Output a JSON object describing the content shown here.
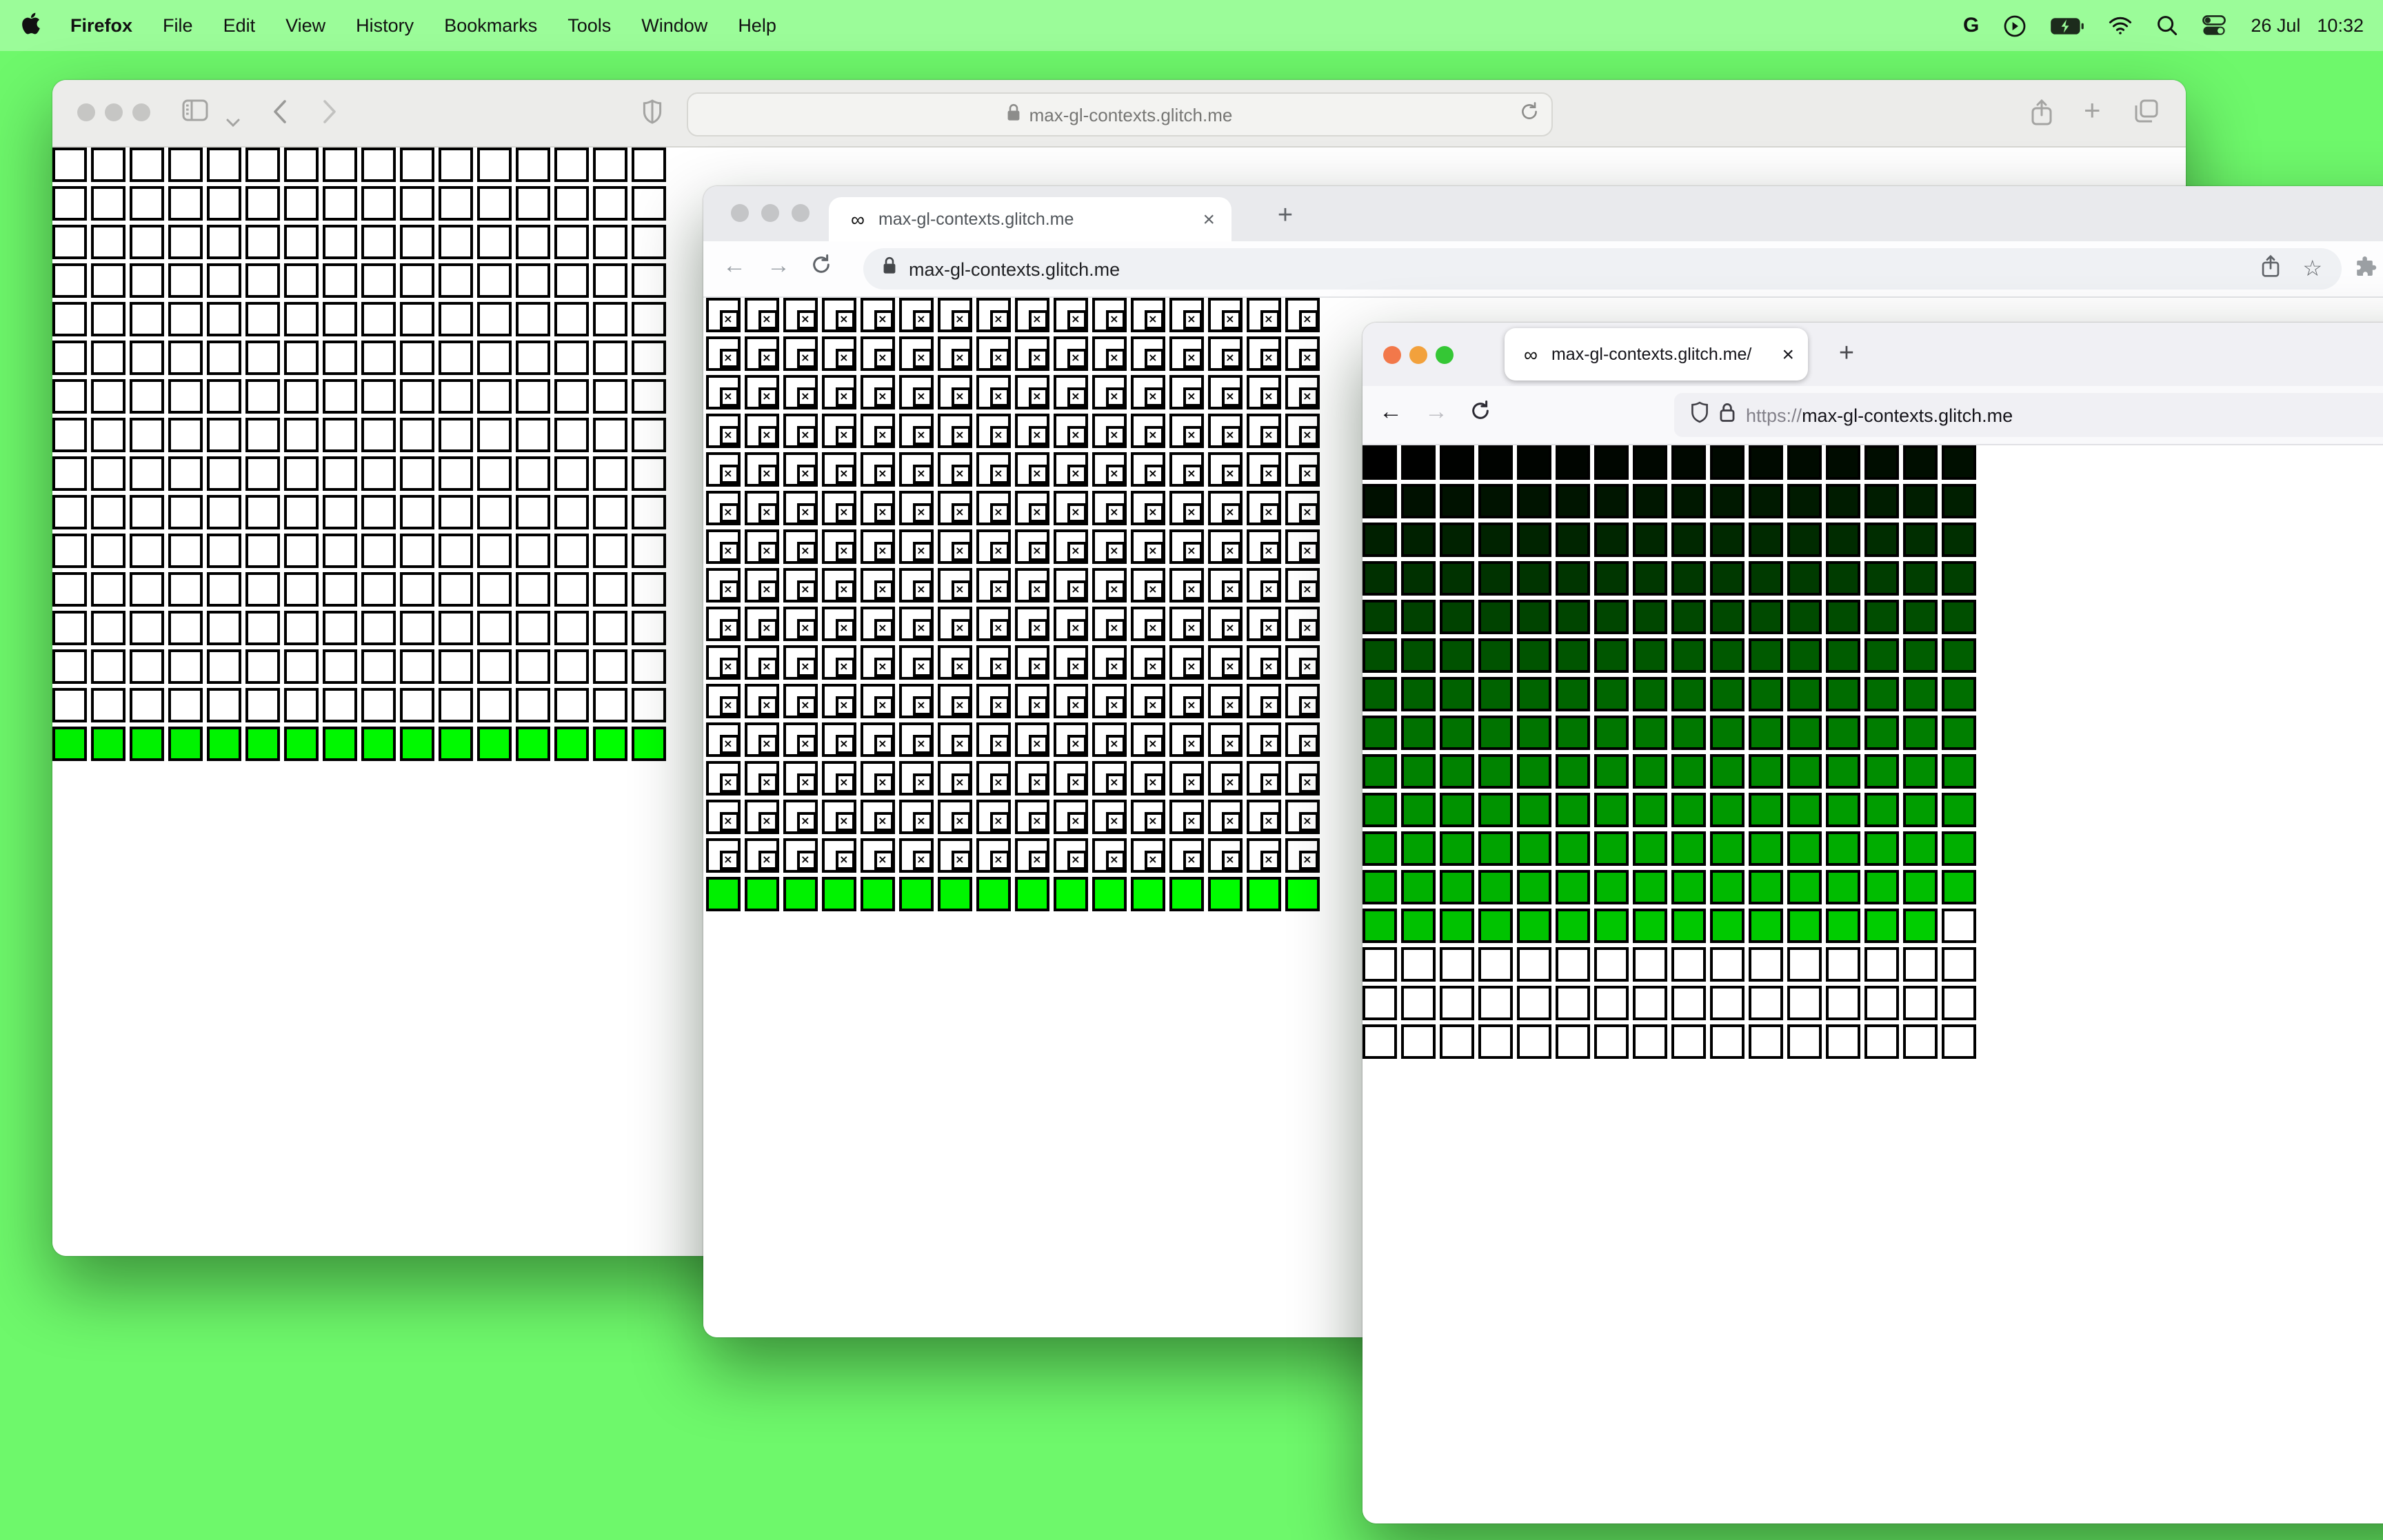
{
  "menu_bar": {
    "app_name": "Firefox",
    "items": [
      "File",
      "Edit",
      "View",
      "History",
      "Bookmarks",
      "Tools",
      "Window",
      "Help"
    ],
    "date": "26 Jul",
    "time": "10:32",
    "status_icon_names": [
      "google-g",
      "play-circle",
      "battery-charging",
      "wifi",
      "spotlight-search",
      "control-center"
    ],
    "google_g": "G"
  },
  "glyphs": {
    "infinity": "∞",
    "close": "×",
    "plus": "+",
    "back": "←",
    "forward": "→",
    "star": "☆"
  },
  "safari_window": {
    "url": "max-gl-contexts.glitch.me",
    "grid": {
      "cols": 16,
      "rows": 16,
      "pattern": "evicted-blank",
      "live_from": 240,
      "live_color_formula": "rgb(0,index,0)",
      "blank_color": "#ffffff",
      "note": "rows 1-15 blank white squares, bottom row of 16 bright green squares"
    }
  },
  "chrome_window": {
    "tab_title": "max-gl-contexts.glitch.me",
    "url": "max-gl-contexts.glitch.me",
    "grid": {
      "cols": 16,
      "rows": 16,
      "pattern": "broken-placeholders",
      "live_from": 240,
      "live_color_formula": "rgb(0,index,0)",
      "blank_color": "#ffffff",
      "note": "rows 1-15 white squares with broken-image placeholder icons, bottom row of 16 bright green squares"
    }
  },
  "firefox_window": {
    "tab_title": "max-gl-contexts.glitch.me/",
    "url_prefix": "https://",
    "url_domain": "max-gl-contexts.glitch.me",
    "grid": {
      "cols": 16,
      "rows": 16,
      "pattern": "gradient-then-lost",
      "live_count": 207,
      "live_color_formula": "rgb(0,index,0)",
      "blank_color": "#ffffff",
      "note": "cells 0-206 shade from black to bright green row-major, remaining 49 cells white"
    }
  },
  "colors": {
    "desktop_green": "#6ef86b",
    "menubar_green": "#9bfc99",
    "cell_border": "#000000",
    "cell_blank": "#ffffff",
    "safari_toolbar": "#ececea",
    "inactive_traffic_light": "#c6c6c4",
    "chrome_tabbar": "#e9eaed",
    "chrome_pill": "#eff1f4",
    "firefox_tabbar": "#f0f0f4",
    "firefox_toolbar": "#f9f9fb",
    "firefox_field": "#f0f0f4",
    "ff_light_close": "#f2784a",
    "ff_light_min": "#f2a13c",
    "ff_light_zoom": "#35c735"
  }
}
